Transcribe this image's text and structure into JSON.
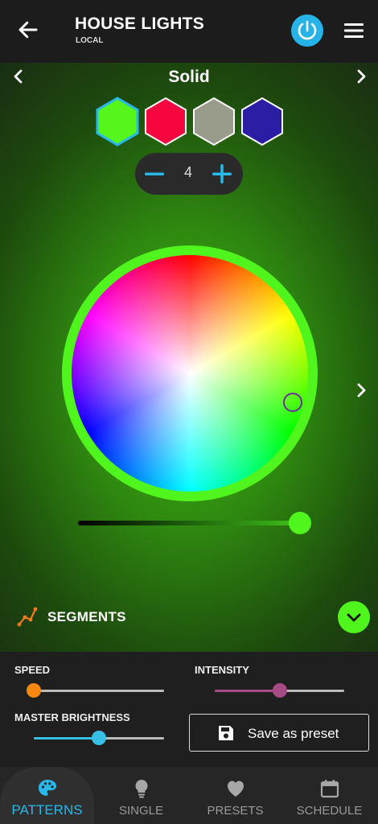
{
  "header": {
    "title": "HOUSE LIGHTS",
    "subtitle": "LOCAL"
  },
  "pattern": {
    "name": "Solid"
  },
  "swatches": [
    {
      "color": "#56f51b",
      "selected": true
    },
    {
      "color": "#f5063f",
      "selected": false
    },
    {
      "color": "#999c8b",
      "selected": false
    },
    {
      "color": "#2a1fa4",
      "selected": false
    }
  ],
  "color_count": "4",
  "brightness": {
    "value_fraction": 0.98
  },
  "segments": {
    "label": "SEGMENTS"
  },
  "controls": {
    "speed": {
      "label": "SPEED",
      "value_fraction": 0.0
    },
    "intensity": {
      "label": "INTENSITY",
      "value_fraction": 0.5
    },
    "master_brightness": {
      "label": "MASTER BRIGHTNESS",
      "value_fraction": 0.5
    },
    "save_preset_label": "Save as preset"
  },
  "bottom_nav": [
    {
      "label": "PATTERNS",
      "icon": "palette-icon",
      "active": true
    },
    {
      "label": "SINGLE",
      "icon": "bulb-icon",
      "active": false
    },
    {
      "label": "PRESETS",
      "icon": "heart-icon",
      "active": false
    },
    {
      "label": "SCHEDULE",
      "icon": "calendar-icon",
      "active": false
    }
  ],
  "colors": {
    "accent_blue": "#29b8ec",
    "accent_green": "#4ff51d",
    "speed_orange": "#f7870e",
    "intensity_purple": "#a54b86",
    "master_blue": "#37bfe6"
  }
}
